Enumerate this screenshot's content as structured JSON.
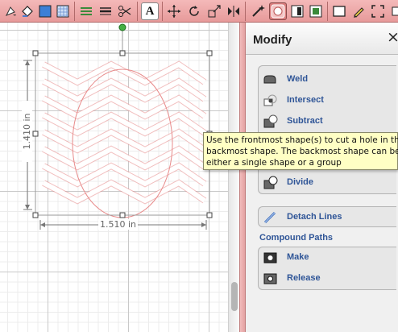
{
  "toolbar": {
    "buttons": [
      {
        "name": "fill-tool-icon"
      },
      {
        "name": "color-square-icon"
      },
      {
        "name": "pattern-fill-icon"
      },
      {
        "name": "line-style-icon"
      },
      {
        "name": "dash-style-icon"
      },
      {
        "name": "scissors-icon"
      },
      {
        "name": "text-tool-icon"
      },
      {
        "name": "move-icon"
      },
      {
        "name": "rotate-icon"
      },
      {
        "name": "resize-icon"
      },
      {
        "name": "flip-icon"
      },
      {
        "name": "magic-wand-icon"
      },
      {
        "name": "shape-mode-icon"
      },
      {
        "name": "align-icon"
      },
      {
        "name": "layers-icon"
      },
      {
        "name": "rectangle-icon"
      },
      {
        "name": "pencil-icon"
      },
      {
        "name": "fit-window-icon"
      },
      {
        "name": "more-icon"
      }
    ],
    "text_tool_glyph": "A",
    "accent": "#eba5a5"
  },
  "canvas": {
    "width_label": "1.510 in",
    "height_label": "1.410 in",
    "shape_color": "#e88a8a"
  },
  "panel": {
    "title": "Modify",
    "close_glyph": "×",
    "items": [
      {
        "label": "Weld"
      },
      {
        "label": "Intersect"
      },
      {
        "label": "Subtract"
      },
      {
        "label": "Divide"
      }
    ],
    "detach": {
      "label": "Detach Lines"
    },
    "compound_heading": "Compound Paths",
    "compound_items": [
      {
        "label": "Make"
      },
      {
        "label": "Release"
      }
    ],
    "label_color": "#2f5597"
  },
  "tooltip": {
    "line1": "Use the frontmost shape(s) to cut a hole in th",
    "line2": "backmost shape. The backmost shape can be",
    "line3": "either a single shape or a group"
  }
}
